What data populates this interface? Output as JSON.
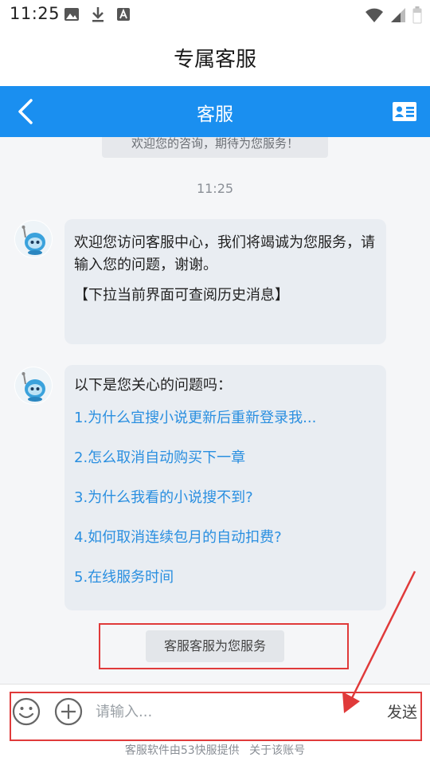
{
  "status_bar": {
    "time": "11:25",
    "left_icons": [
      "image-icon",
      "download-icon",
      "a-letter-icon"
    ],
    "right_icons": [
      "wifi-icon",
      "signal-icon",
      "battery-icon"
    ]
  },
  "page": {
    "title": "专属客服"
  },
  "nav": {
    "title": "客服",
    "back_icon": "chevron-left-icon",
    "card_icon": "contact-card-icon",
    "bg_color": "#1a8ff0"
  },
  "chat": {
    "welcome_pill": "欢迎您的咨询，期待为您服务！",
    "timestamp": "11:25",
    "messages": [
      {
        "avatar_icon": "robot-avatar-icon",
        "text": "欢迎您访问客服中心，我们将竭诚为您服务，请输入您的问题，谢谢。",
        "note": "【下拉当前界面可查阅历史消息】"
      },
      {
        "avatar_icon": "robot-avatar-icon",
        "intro": "以下是您关心的问题吗：",
        "questions": [
          "1.为什么宜搜小说更新后重新登录我...",
          "2.怎么取消自动购买下一章",
          "3.为什么我看的小说搜不到?",
          "4.如何取消连续包月的自动扣费?",
          "5.在线服务时间"
        ]
      }
    ],
    "service_tag": "客服客服为您服务"
  },
  "input": {
    "placeholder": "请输入...",
    "value": "",
    "send_label": "发送",
    "emoji_icon": "smiley-icon",
    "plus_icon": "plus-circle-icon"
  },
  "footer": {
    "provider_text": "客服软件由53快服提供",
    "about_link": "关于该账号"
  },
  "colors": {
    "link": "#2a8fe0",
    "annotation": "#e03a3a"
  }
}
